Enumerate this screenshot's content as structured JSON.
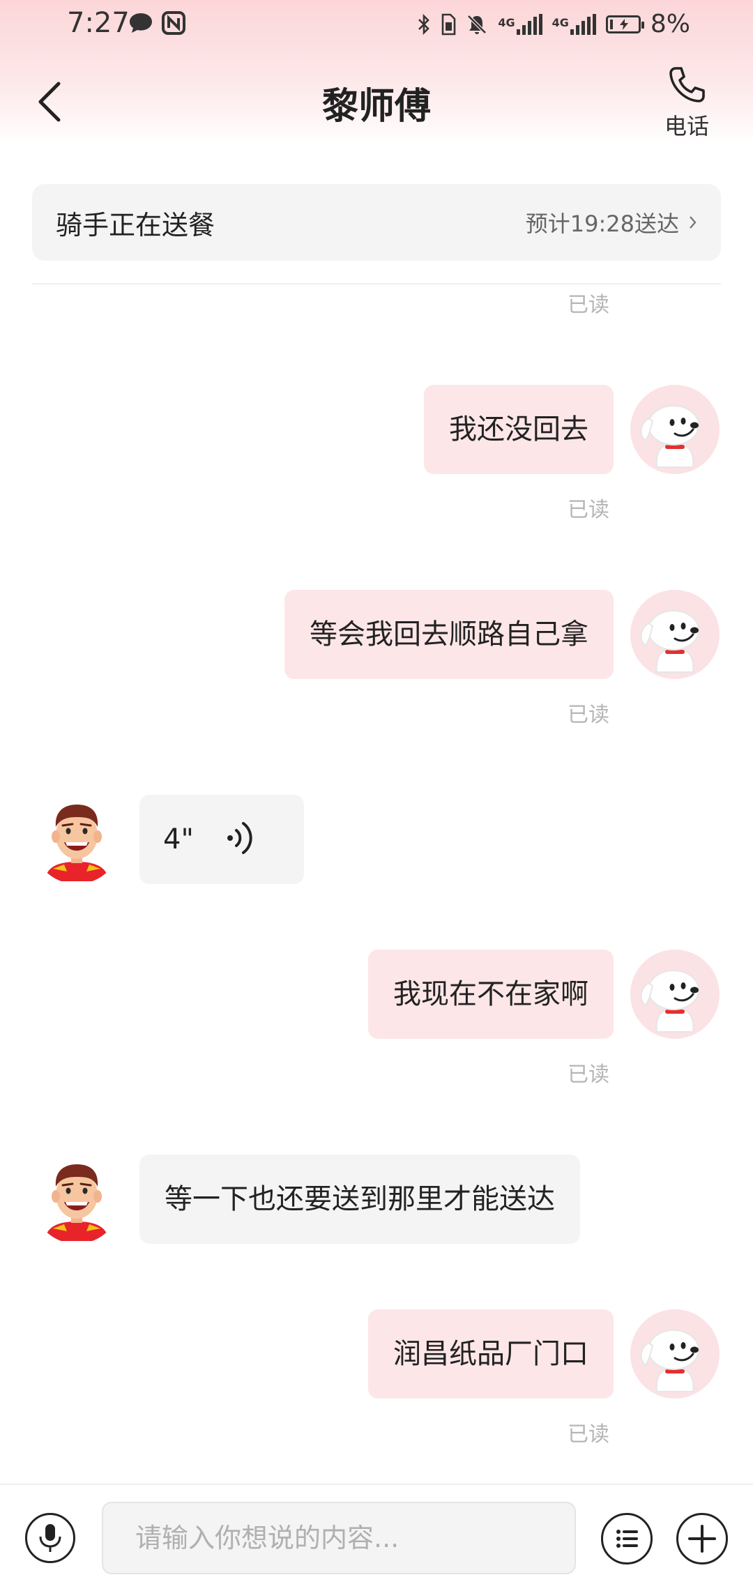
{
  "status_bar": {
    "time": "7:27",
    "network_1": "4G",
    "network_2": "4G",
    "battery_percent": "8%",
    "icons": [
      "chat-icon",
      "nfc-icon",
      "bluetooth-icon",
      "sim-icon",
      "mute-bell-icon",
      "signal-icon",
      "signal-icon",
      "battery-charging-icon"
    ]
  },
  "header": {
    "title": "黎师傅",
    "call_label": "电话"
  },
  "banner": {
    "title": "骑手正在送餐",
    "eta": "预计19:28送达"
  },
  "colors": {
    "my_bubble": "#fde6e8",
    "their_bubble": "#f4f4f4",
    "read_status": "#b5b5b5",
    "header_gradient": "#fcd6d8"
  },
  "messages": [
    {
      "from": "me",
      "text": "我还没回去",
      "status": "已读"
    },
    {
      "from": "me",
      "text": "等会我回去顺路自己拿",
      "status": "已读"
    },
    {
      "from": "rider",
      "type": "voice",
      "duration": "4\"",
      "icon": "voice-wave-icon"
    },
    {
      "from": "me",
      "text": "我现在不在家啊",
      "status": "已读"
    },
    {
      "from": "rider",
      "text": "等一下也还要送到那里才能送达"
    },
    {
      "from": "me",
      "text": "润昌纸品厂门口",
      "status": "已读"
    }
  ],
  "top_read_status": "已读",
  "input": {
    "placeholder": "请输入你想说的内容..."
  }
}
